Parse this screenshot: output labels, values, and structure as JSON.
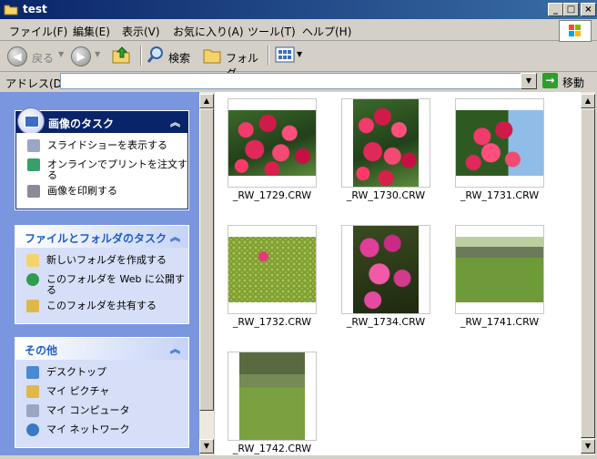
{
  "window": {
    "title": "test"
  },
  "menu": [
    "ファイル(F)",
    "編集(E)",
    "表示(V)",
    "お気に入り(A)",
    "ツール(T)",
    "ヘルプ(H)"
  ],
  "toolbar": {
    "back": "戻る",
    "search": "検索",
    "folders": "フォルダ"
  },
  "address": {
    "label": "アドレス(D)",
    "value": "",
    "go": "移動"
  },
  "panels": {
    "image_tasks": {
      "title": "画像のタスク",
      "links": [
        "スライドショーを表示する",
        "オンラインでプリントを注文する",
        "画像を印刷する"
      ]
    },
    "file_tasks": {
      "title": "ファイルとフォルダのタスク",
      "links": [
        "新しいフォルダを作成する",
        "このフォルダを Web に公開する",
        "このフォルダを共有する"
      ]
    },
    "other": {
      "title": "その他",
      "links": [
        "デスクトップ",
        "マイ ピクチャ",
        "マイ コンピュータ",
        "マイ ネットワーク"
      ]
    }
  },
  "files": [
    {
      "name": "_RW_1729.CRW"
    },
    {
      "name": "_RW_1730.CRW"
    },
    {
      "name": "_RW_1731.CRW"
    },
    {
      "name": "_RW_1732.CRW"
    },
    {
      "name": "_RW_1734.CRW"
    },
    {
      "name": "_RW_1741.CRW"
    },
    {
      "name": "_RW_1742.CRW"
    }
  ]
}
